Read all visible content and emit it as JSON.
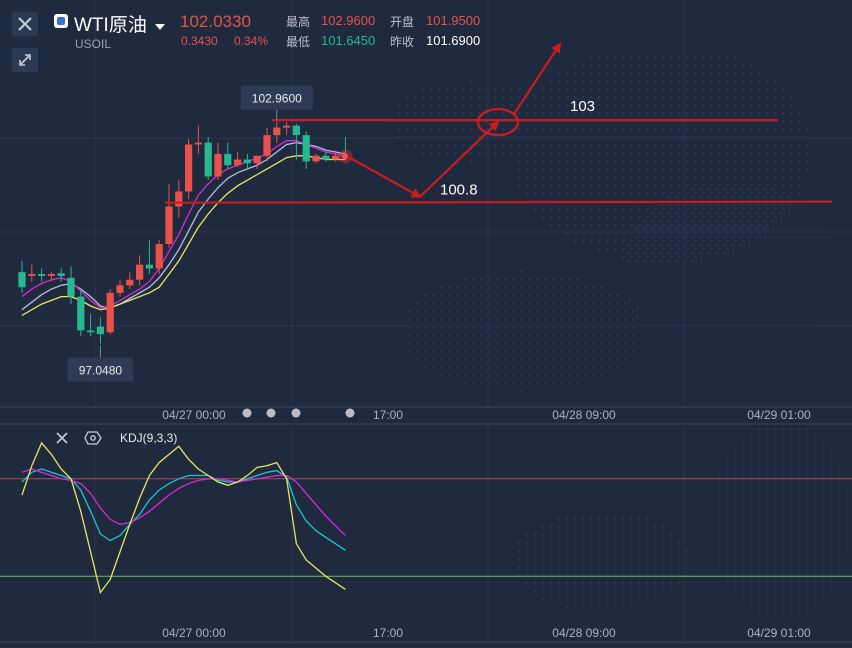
{
  "header": {
    "symbol_name": "WTI原油",
    "symbol_code": "USOIL",
    "price": "102.0330",
    "change": "0.3430",
    "change_pct": "0.34%",
    "high_label": "最高",
    "high_value": "102.9600",
    "open_label": "开盘",
    "open_value": "101.9500",
    "low_label": "最低",
    "low_value": "101.6450",
    "prev_close_label": "昨收",
    "prev_close_value": "101.6900"
  },
  "colors": {
    "up": "#e8524a",
    "down": "#27b890",
    "ma_white": "#b7bce6",
    "ma_magenta": "#d42cd4",
    "ma_yellow": "#e6e85a",
    "kdj_k": "#19c7cf",
    "kdj_d": "#d42cd4",
    "kdj_j": "#e6e85a",
    "annotation": "#cc1c1c",
    "background": "#1f2a3f"
  },
  "icons": {
    "close": "close-icon",
    "expand": "expand-icon",
    "symbol": "symbol-badge-icon",
    "dropdown": "chevron-down-icon",
    "settings": "hexagon-settings-icon"
  },
  "chart_data": [
    {
      "type": "candlestick",
      "categories": [
        "c1",
        "c2",
        "c3",
        "c4",
        "c5",
        "c6",
        "c7",
        "c8",
        "c9",
        "c10",
        "c11",
        "c12",
        "c13",
        "c14",
        "c15",
        "c16",
        "c17",
        "c18",
        "c19",
        "c20",
        "c21",
        "c22",
        "c23",
        "c24",
        "c25",
        "c26",
        "c27",
        "c28",
        "c29",
        "c30",
        "c31",
        "c32",
        "c33",
        "c34"
      ],
      "x_tick_labels": [
        "04/27 00:00",
        "17:00",
        "04/28 09:00",
        "04/29 01:00"
      ],
      "ylim": [
        95.6,
        104.6
      ],
      "high_marker": "102.9600",
      "low_marker": "97.0480",
      "candles": [
        {
          "o": 98.95,
          "h": 99.25,
          "c": 98.55,
          "l": 98.4
        },
        {
          "o": 98.85,
          "h": 99.15,
          "c": 98.9,
          "l": 98.7
        },
        {
          "o": 98.9,
          "h": 99.05,
          "c": 98.85,
          "l": 98.7
        },
        {
          "o": 98.85,
          "h": 98.95,
          "c": 98.9,
          "l": 98.7
        },
        {
          "o": 98.92,
          "h": 99.05,
          "c": 98.85,
          "l": 98.7
        },
        {
          "o": 98.8,
          "h": 99.1,
          "c": 98.3,
          "l": 98.1
        },
        {
          "o": 98.3,
          "h": 98.5,
          "c": 97.4,
          "l": 97.25
        },
        {
          "o": 97.4,
          "h": 97.85,
          "c": 97.35,
          "l": 97.25
        },
        {
          "o": 97.5,
          "h": 97.75,
          "c": 97.3,
          "l": 97.05
        },
        {
          "o": 97.35,
          "h": 98.5,
          "c": 98.4,
          "l": 97.3
        },
        {
          "o": 98.4,
          "h": 98.75,
          "c": 98.6,
          "l": 98.3
        },
        {
          "o": 98.6,
          "h": 98.95,
          "c": 98.75,
          "l": 98.5
        },
        {
          "o": 98.75,
          "h": 99.4,
          "c": 99.15,
          "l": 98.6
        },
        {
          "o": 99.15,
          "h": 99.8,
          "c": 99.05,
          "l": 98.9
        },
        {
          "o": 99.05,
          "h": 99.8,
          "c": 99.7,
          "l": 98.9
        },
        {
          "o": 99.7,
          "h": 101.3,
          "c": 100.7,
          "l": 99.6
        },
        {
          "o": 100.7,
          "h": 101.4,
          "c": 101.1,
          "l": 100.4
        },
        {
          "o": 101.1,
          "h": 102.5,
          "c": 102.35,
          "l": 100.9
        },
        {
          "o": 102.35,
          "h": 102.85,
          "c": 102.4,
          "l": 102.1
        },
        {
          "o": 102.4,
          "h": 102.55,
          "c": 101.5,
          "l": 101.4
        },
        {
          "o": 101.5,
          "h": 102.4,
          "c": 102.1,
          "l": 101.4
        },
        {
          "o": 102.1,
          "h": 102.4,
          "c": 101.8,
          "l": 101.7
        },
        {
          "o": 101.8,
          "h": 102.15,
          "c": 101.95,
          "l": 101.75
        },
        {
          "o": 101.95,
          "h": 102.1,
          "c": 101.85,
          "l": 101.7
        },
        {
          "o": 101.85,
          "h": 102.05,
          "c": 102.05,
          "l": 101.7
        },
        {
          "o": 102.05,
          "h": 102.8,
          "c": 102.6,
          "l": 101.9
        },
        {
          "o": 102.6,
          "h": 102.96,
          "c": 102.8,
          "l": 102.4
        },
        {
          "o": 102.8,
          "h": 102.95,
          "c": 102.85,
          "l": 102.6
        },
        {
          "o": 102.85,
          "h": 102.9,
          "c": 102.6,
          "l": 101.95
        },
        {
          "o": 102.6,
          "h": 102.7,
          "c": 101.9,
          "l": 101.7
        },
        {
          "o": 101.9,
          "h": 102.1,
          "c": 102.05,
          "l": 101.85
        },
        {
          "o": 102.05,
          "h": 102.15,
          "c": 101.95,
          "l": 101.9
        },
        {
          "o": 101.95,
          "h": 102.2,
          "c": 102.05,
          "l": 101.9
        },
        {
          "o": 102.05,
          "h": 102.55,
          "c": 102.03,
          "l": 101.95
        }
      ],
      "moving_averages": [
        {
          "color_key": "ma_white",
          "values": [
            97.95,
            98.15,
            98.35,
            98.5,
            98.6,
            98.65,
            98.5,
            98.3,
            98.05,
            98.0,
            98.1,
            98.25,
            98.4,
            98.55,
            98.8,
            99.15,
            99.55,
            100.05,
            100.55,
            100.9,
            101.2,
            101.45,
            101.6,
            101.7,
            101.8,
            101.95,
            102.15,
            102.35,
            102.4,
            102.35,
            102.3,
            102.2,
            102.15,
            102.1
          ]
        },
        {
          "color_key": "ma_magenta",
          "values": [
            98.3,
            98.5,
            98.65,
            98.75,
            98.8,
            98.7,
            98.45,
            98.2,
            98.0,
            98.05,
            98.2,
            98.35,
            98.5,
            98.7,
            99.05,
            99.5,
            99.95,
            100.5,
            101.0,
            101.3,
            101.55,
            101.7,
            101.8,
            101.9,
            101.98,
            102.1,
            102.3,
            102.45,
            102.45,
            102.35,
            102.25,
            102.15,
            102.1,
            102.05
          ]
        },
        {
          "color_key": "ma_yellow",
          "values": [
            97.8,
            97.95,
            98.1,
            98.2,
            98.3,
            98.3,
            98.2,
            98.05,
            97.95,
            98.0,
            98.1,
            98.2,
            98.3,
            98.4,
            98.55,
            98.9,
            99.25,
            99.7,
            100.15,
            100.5,
            100.8,
            101.05,
            101.25,
            101.4,
            101.55,
            101.7,
            101.85,
            102.0,
            102.05,
            102.05,
            102.0,
            101.95,
            101.95,
            101.95
          ]
        }
      ],
      "annotations": [
        {
          "label": "103",
          "price": 103.0
        },
        {
          "label": "100.8",
          "price": 100.8
        }
      ]
    },
    {
      "type": "line",
      "title": "KDJ(9,3,3)",
      "x_tick_labels": [
        "04/27 00:00",
        "17:00",
        "04/28 09:00",
        "04/29 01:00"
      ],
      "ylim": [
        -10,
        110
      ],
      "reference_lines": [
        {
          "value": 80,
          "color": "#b04a5a"
        },
        {
          "value": 20,
          "color": "#6fbf5a"
        }
      ],
      "series": [
        {
          "color_key": "kdj_k",
          "values": [
            78,
            84,
            86,
            84,
            82,
            80,
            73,
            60,
            46,
            42,
            45,
            52,
            58,
            67,
            73,
            77,
            80,
            82,
            82,
            82,
            79,
            78,
            78,
            80,
            82,
            84,
            85,
            81,
            64,
            54,
            48,
            44,
            40,
            36
          ]
        },
        {
          "color_key": "kdj_d",
          "values": [
            84,
            86,
            84,
            82,
            80,
            79,
            77,
            71,
            62,
            55,
            52,
            53,
            56,
            60,
            65,
            70,
            74,
            77,
            79,
            80,
            80,
            79,
            78,
            79,
            80,
            81,
            82,
            82,
            78,
            71,
            64,
            57,
            51,
            45
          ]
        },
        {
          "color_key": "kdj_j",
          "values": [
            70,
            88,
            102,
            95,
            86,
            80,
            60,
            35,
            10,
            18,
            35,
            52,
            68,
            82,
            90,
            95,
            100,
            92,
            86,
            82,
            78,
            76,
            78,
            82,
            87,
            88,
            90,
            80,
            40,
            30,
            25,
            20,
            16,
            12
          ]
        }
      ]
    }
  ]
}
